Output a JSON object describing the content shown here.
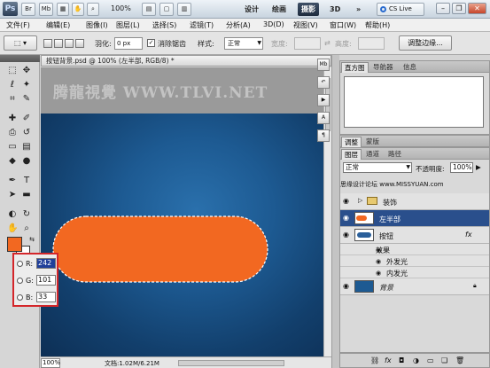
{
  "app": {
    "logo": "Ps",
    "br_label": "Br",
    "mb_label": "Mb",
    "zoom": "100%",
    "workspaces": [
      "设计",
      "绘画",
      "摄影",
      "3D"
    ],
    "active_workspace": "摄影",
    "more": "»",
    "cslive": "CS Live"
  },
  "menu": [
    "文件(F)",
    "编辑(E)",
    "图像(I)",
    "图层(L)",
    "选择(S)",
    "滤镜(T)",
    "分析(A)",
    "3D(D)",
    "视图(V)",
    "窗口(W)",
    "帮助(H)"
  ],
  "options": {
    "feather_label": "羽化:",
    "feather_value": "0 px",
    "antialias_label": "消除锯齿",
    "style_label": "样式:",
    "style_value": "正常",
    "width_label": "宽度:",
    "height_label": "高度:",
    "refine_edge": "调整边缘..."
  },
  "document": {
    "tab_title": "按钮背景.psd @ 100% (左半部, RGB/8) *",
    "close": "×",
    "watermark": "腾龍視覺 WWW.TLVI.NET",
    "zoom": "100%",
    "doc_info": "文档:1.02M/6.21M"
  },
  "rgb_picker": {
    "r_label": "R:",
    "r_value": "242",
    "g_label": "G:",
    "g_value": "101",
    "b_label": "B:",
    "b_value": "33"
  },
  "panels": {
    "top_tabs": [
      "直方图",
      "导航器",
      "信息"
    ],
    "mid_tabs": [
      "调整",
      "蒙版"
    ],
    "layer_tabs": [
      "图层",
      "通道",
      "路径"
    ],
    "blend_mode": "正常",
    "opacity_label": "不透明度:",
    "opacity_value": "100%",
    "lock_fill_overlay": "思缘设计论坛 www.MISSYUAN.com",
    "layers": [
      {
        "name": "装饰",
        "kind": "group"
      },
      {
        "name": "左半部",
        "kind": "selected"
      },
      {
        "name": "按钮",
        "kind": "fx"
      },
      {
        "name": "效果",
        "kind": "effects-header"
      },
      {
        "name": "外发光",
        "kind": "effect"
      },
      {
        "name": "内发光",
        "kind": "effect"
      },
      {
        "name": "背景",
        "kind": "background"
      }
    ],
    "fx_mark": "fx"
  },
  "colors": {
    "foreground": "#f26821",
    "canvas_blue": "#1d5a92",
    "selection": "#2a4f8c",
    "callout_border": "#d4262a"
  }
}
